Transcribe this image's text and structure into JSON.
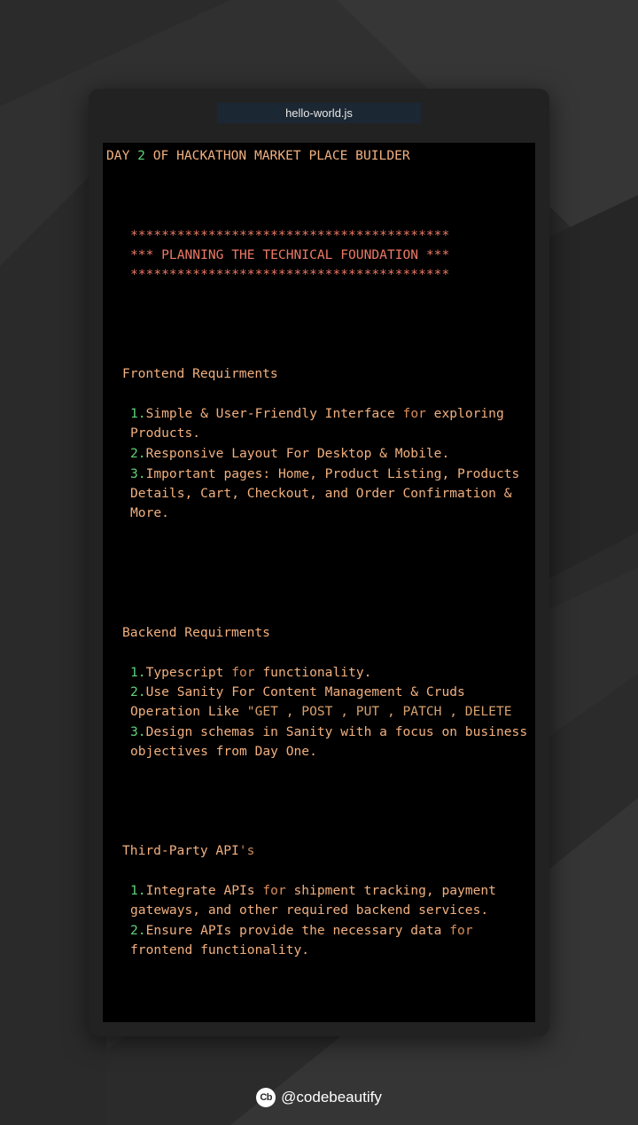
{
  "tab": {
    "filename": "hello-world.js"
  },
  "code": {
    "title": {
      "a": "DAY ",
      "num": "2",
      "b": " OF HACKATHON MARKET PLACE BUILDER"
    },
    "banner": {
      "stars": "*****************************************",
      "heading": "*** PLANNING THE TECHNICAL FOUNDATION ***"
    },
    "frontend": {
      "heading": "Frontend Requirments",
      "items": [
        {
          "num": "1.",
          "pre": "Simple & User-Friendly Interface ",
          "kw": "for",
          "post": " exploring",
          "cont": "Products."
        },
        {
          "num": "2.",
          "text": "Responsive Layout For Desktop & Mobile."
        },
        {
          "num": "3.",
          "text": "Important pages: Home, Product Listing, Products",
          "cont1": "Details, Cart, Checkout, and Order Confirmation &",
          "cont2": "More."
        }
      ]
    },
    "backend": {
      "heading": "Backend Requirments",
      "items": [
        {
          "num": "1.",
          "pre": "Typescript ",
          "kw": "for",
          "post": " functionality."
        },
        {
          "num": "2.",
          "text": "Use Sanity For Content Management & Cruds",
          "cont_pre": "Operation Like ",
          "cont_str": "\"GET , POST , PUT , PATCH , DELETE"
        },
        {
          "num": "3.",
          "text": "Design schemas in Sanity with a focus on business",
          "cont": "objectives from Day One."
        }
      ]
    },
    "thirdparty": {
      "heading_pre": "Third-Party API",
      "heading_sq": "'s",
      "items": [
        {
          "num": "1.",
          "pre": "Integrate APIs ",
          "kw": "for",
          "post": " shipment tracking, payment",
          "cont": "gateways, and other required backend services."
        },
        {
          "num": "2.",
          "pre": "Ensure APIs provide the necessary data ",
          "kw": "for",
          "cont": "frontend functionality."
        }
      ]
    }
  },
  "footer": {
    "logo_text": "Cb",
    "handle": "@codebeautify"
  },
  "colors": {
    "background": "#2b2b2b",
    "window": "#222222",
    "editor": "#000000",
    "text": "#f2b07f",
    "number": "#5fd27a",
    "stars": "#ee7a66"
  }
}
